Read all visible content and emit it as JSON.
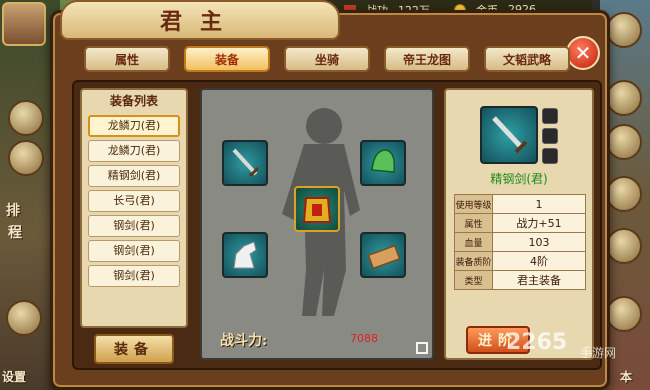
{
  "hud": {
    "battle_power_label": "战功",
    "battle_power_value": "122万",
    "gold_label": "金币",
    "gold_value": "2926"
  },
  "side": {
    "left_text_1": "排",
    "left_text_2": "程",
    "left_text_bottom": "设置",
    "right_text_bottom": "本"
  },
  "window": {
    "title": "君主",
    "close_label": "✕"
  },
  "tabs": [
    {
      "label": "属性",
      "active": false
    },
    {
      "label": "装备",
      "active": true
    },
    {
      "label": "坐骑",
      "active": false
    },
    {
      "label": "帝王龙图",
      "active": false
    },
    {
      "label": "文韬武略",
      "active": false
    }
  ],
  "equip_list": {
    "header": "装备列表",
    "items": [
      {
        "label": "龙鳞刀(君)",
        "selected": true
      },
      {
        "label": "龙鳞刀(君)",
        "selected": false
      },
      {
        "label": "精钢剑(君)",
        "selected": false
      },
      {
        "label": "长弓(君)",
        "selected": false
      },
      {
        "label": "钢剑(君)",
        "selected": false
      },
      {
        "label": "钢剑(君)",
        "selected": false
      },
      {
        "label": "钢剑(君)",
        "selected": false
      }
    ],
    "equip_button": "装备"
  },
  "character": {
    "power_label": "战斗力:",
    "power_value": "7088",
    "slots": [
      {
        "name": "sword-slot",
        "icon": "sword-icon"
      },
      {
        "name": "helmet-slot",
        "icon": "helmet-icon"
      },
      {
        "name": "armor-slot",
        "icon": "armor-icon"
      },
      {
        "name": "horse-slot",
        "icon": "horse-icon"
      },
      {
        "name": "scroll-slot",
        "icon": "scroll-icon"
      }
    ]
  },
  "detail": {
    "item_name": "精钢剑(君)",
    "stats": [
      {
        "key": "使用等级",
        "value": "1"
      },
      {
        "key": "属性",
        "value": "战力+51"
      },
      {
        "key": "血量",
        "value": "103"
      },
      {
        "key": "装备质阶",
        "value": "4阶"
      },
      {
        "key": "类型",
        "value": "君主装备"
      }
    ],
    "advance_button": "进阶"
  },
  "watermark": {
    "main": "2265",
    "sub": "手游网"
  },
  "colors": {
    "panel_brown": "#6b3f1e",
    "parchment": "#e8d8b0",
    "item_green": "#1a8a1a",
    "slot_teal": "#2f9aa0",
    "power_red": "#e02020"
  }
}
